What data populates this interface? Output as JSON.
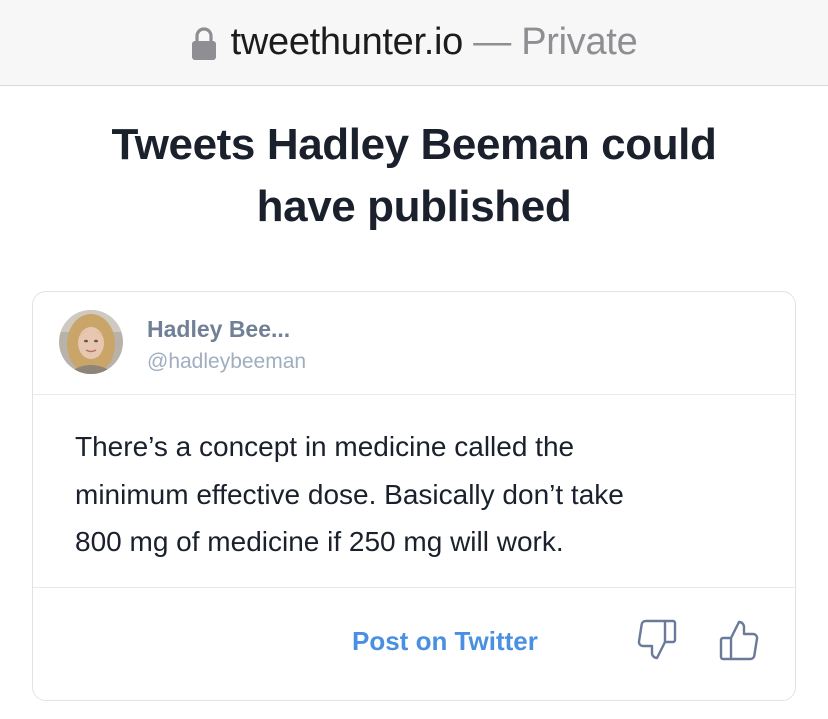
{
  "browser": {
    "domain": "tweethunter.io",
    "separator": " — ",
    "mode": "Private",
    "icon": "lock-icon"
  },
  "page": {
    "title_line1": "Tweets Hadley Beeman could",
    "title_line2": "have published"
  },
  "tweet": {
    "display_name": "Hadley Bee...",
    "handle": "@hadleybeeman",
    "text_line1": "There’s a concept in medicine called the",
    "text_line2": "minimum effective dose. Basically don’t take",
    "text_line3": "800 mg of medicine if 250 mg will work.",
    "post_button_label": "Post on Twitter",
    "icons": [
      "thumbs-down-icon",
      "thumbs-up-icon"
    ]
  },
  "colors": {
    "link": "#4a90e2",
    "title": "#1a202c",
    "name": "#718096",
    "handle": "#a0aec0",
    "border": "#dfe3e8"
  }
}
